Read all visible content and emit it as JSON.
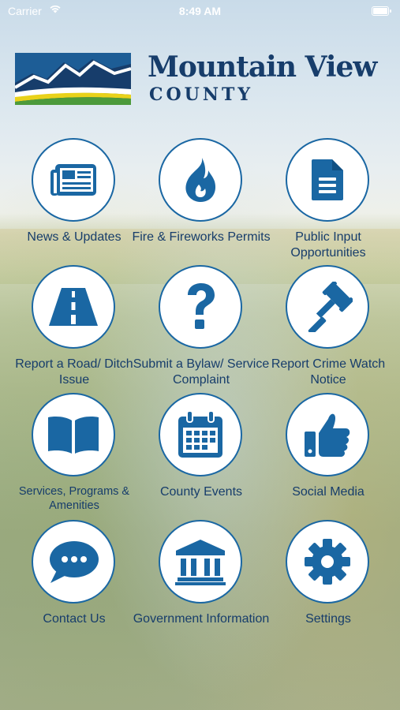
{
  "status_bar": {
    "carrier": "Carrier",
    "time": "8:49 AM",
    "battery_percent": 100
  },
  "logo": {
    "title": "Mountain View",
    "subtitle": "COUNTY",
    "colors": {
      "navy": "#173d6b",
      "blue": "#1a67a3",
      "yellow": "#e9d21a",
      "green": "#4c9a3b"
    }
  },
  "colors": {
    "accent": "#1a67a3",
    "text": "#173d6b",
    "tile_bg": "#ffffff"
  },
  "menu": [
    {
      "label": "News & Updates",
      "icon": "newspaper-icon"
    },
    {
      "label": "Fire & Fireworks Permits",
      "icon": "flame-icon"
    },
    {
      "label": "Public Input Opportunities",
      "icon": "document-icon"
    },
    {
      "label": "Report a Road/ Ditch Issue",
      "icon": "road-icon"
    },
    {
      "label": "Submit a Bylaw/ Service Complaint",
      "icon": "question-mark-icon"
    },
    {
      "label": "Report Crime Watch Notice",
      "icon": "gavel-icon"
    },
    {
      "label": "Services, Programs & Amenities",
      "icon": "book-icon"
    },
    {
      "label": "County Events",
      "icon": "calendar-icon"
    },
    {
      "label": "Social Media",
      "icon": "thumbs-up-icon"
    },
    {
      "label": "Contact Us",
      "icon": "chat-bubble-icon"
    },
    {
      "label": "Government Information",
      "icon": "government-building-icon"
    },
    {
      "label": "Settings",
      "icon": "gear-icon"
    }
  ]
}
